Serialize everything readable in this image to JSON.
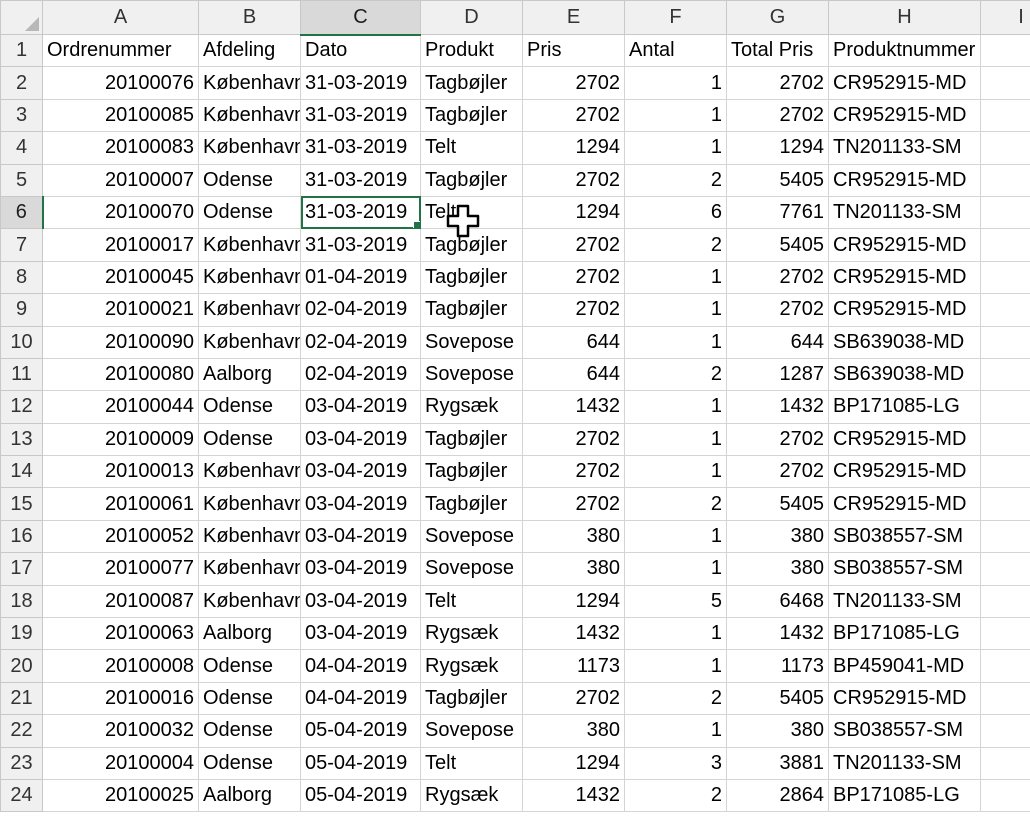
{
  "columns": [
    "A",
    "B",
    "C",
    "D",
    "E",
    "F",
    "G",
    "H",
    "I"
  ],
  "active_cell": {
    "column": "C",
    "row": "6"
  },
  "accent_color": "#217346",
  "cursor_icon": "move-cross-icon",
  "rows": [
    {
      "n": "1",
      "cells": [
        "Ordrenummer",
        "Afdeling",
        "Dato",
        "Produkt",
        "Pris",
        "Antal",
        "Total Pris",
        "Produktnummer",
        ""
      ]
    },
    {
      "n": "2",
      "cells": [
        "20100076",
        "København",
        "31-03-2019",
        "Tagbøjler",
        "2702",
        "1",
        "2702",
        "CR952915-MD",
        ""
      ]
    },
    {
      "n": "3",
      "cells": [
        "20100085",
        "København",
        "31-03-2019",
        "Tagbøjler",
        "2702",
        "1",
        "2702",
        "CR952915-MD",
        ""
      ]
    },
    {
      "n": "4",
      "cells": [
        "20100083",
        "København",
        "31-03-2019",
        "Telt",
        "1294",
        "1",
        "1294",
        "TN201133-SM",
        ""
      ]
    },
    {
      "n": "5",
      "cells": [
        "20100007",
        "Odense",
        "31-03-2019",
        "Tagbøjler",
        "2702",
        "2",
        "5405",
        "CR952915-MD",
        ""
      ]
    },
    {
      "n": "6",
      "cells": [
        "20100070",
        "Odense",
        "31-03-2019",
        "Telt",
        "1294",
        "6",
        "7761",
        "TN201133-SM",
        ""
      ]
    },
    {
      "n": "7",
      "cells": [
        "20100017",
        "København",
        "31-03-2019",
        "Tagbøjler",
        "2702",
        "2",
        "5405",
        "CR952915-MD",
        ""
      ]
    },
    {
      "n": "8",
      "cells": [
        "20100045",
        "København",
        "01-04-2019",
        "Tagbøjler",
        "2702",
        "1",
        "2702",
        "CR952915-MD",
        ""
      ]
    },
    {
      "n": "9",
      "cells": [
        "20100021",
        "København",
        "02-04-2019",
        "Tagbøjler",
        "2702",
        "1",
        "2702",
        "CR952915-MD",
        ""
      ]
    },
    {
      "n": "10",
      "cells": [
        "20100090",
        "København",
        "02-04-2019",
        "Sovepose",
        "644",
        "1",
        "644",
        "SB639038-MD",
        ""
      ]
    },
    {
      "n": "11",
      "cells": [
        "20100080",
        "Aalborg",
        "02-04-2019",
        "Sovepose",
        "644",
        "2",
        "1287",
        "SB639038-MD",
        ""
      ]
    },
    {
      "n": "12",
      "cells": [
        "20100044",
        "Odense",
        "03-04-2019",
        "Rygsæk",
        "1432",
        "1",
        "1432",
        "BP171085-LG",
        ""
      ]
    },
    {
      "n": "13",
      "cells": [
        "20100009",
        "Odense",
        "03-04-2019",
        "Tagbøjler",
        "2702",
        "1",
        "2702",
        "CR952915-MD",
        ""
      ]
    },
    {
      "n": "14",
      "cells": [
        "20100013",
        "København",
        "03-04-2019",
        "Tagbøjler",
        "2702",
        "1",
        "2702",
        "CR952915-MD",
        ""
      ]
    },
    {
      "n": "15",
      "cells": [
        "20100061",
        "København",
        "03-04-2019",
        "Tagbøjler",
        "2702",
        "2",
        "5405",
        "CR952915-MD",
        ""
      ]
    },
    {
      "n": "16",
      "cells": [
        "20100052",
        "København",
        "03-04-2019",
        "Sovepose",
        "380",
        "1",
        "380",
        "SB038557-SM",
        ""
      ]
    },
    {
      "n": "17",
      "cells": [
        "20100077",
        "København",
        "03-04-2019",
        "Sovepose",
        "380",
        "1",
        "380",
        "SB038557-SM",
        ""
      ]
    },
    {
      "n": "18",
      "cells": [
        "20100087",
        "København",
        "03-04-2019",
        "Telt",
        "1294",
        "5",
        "6468",
        "TN201133-SM",
        ""
      ]
    },
    {
      "n": "19",
      "cells": [
        "20100063",
        "Aalborg",
        "03-04-2019",
        "Rygsæk",
        "1432",
        "1",
        "1432",
        "BP171085-LG",
        ""
      ]
    },
    {
      "n": "20",
      "cells": [
        "20100008",
        "Odense",
        "04-04-2019",
        "Rygsæk",
        "1173",
        "1",
        "1173",
        "BP459041-MD",
        ""
      ]
    },
    {
      "n": "21",
      "cells": [
        "20100016",
        "Odense",
        "04-04-2019",
        "Tagbøjler",
        "2702",
        "2",
        "5405",
        "CR952915-MD",
        ""
      ]
    },
    {
      "n": "22",
      "cells": [
        "20100032",
        "Odense",
        "05-04-2019",
        "Sovepose",
        "380",
        "1",
        "380",
        "SB038557-SM",
        ""
      ]
    },
    {
      "n": "23",
      "cells": [
        "20100004",
        "Odense",
        "05-04-2019",
        "Telt",
        "1294",
        "3",
        "3881",
        "TN201133-SM",
        ""
      ]
    },
    {
      "n": "24",
      "cells": [
        "20100025",
        "Aalborg",
        "05-04-2019",
        "Rygsæk",
        "1432",
        "2",
        "2864",
        "BP171085-LG",
        ""
      ]
    }
  ]
}
